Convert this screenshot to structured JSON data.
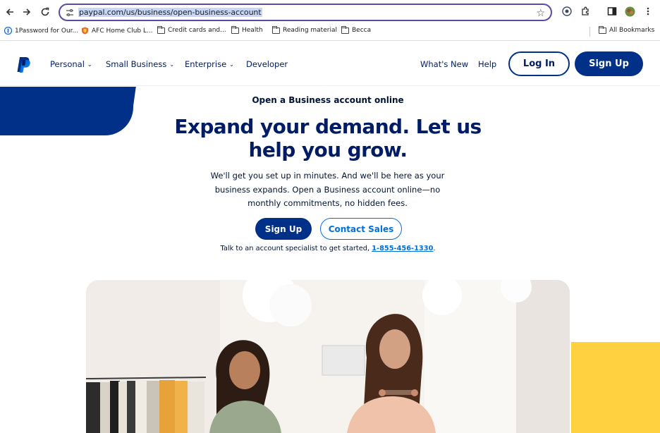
{
  "browser": {
    "url": "paypal.com/us/business/open-business-account",
    "bookmarks": [
      "1Password for Our...",
      "AFC Home Club L...",
      "Credit cards and...",
      "Health",
      "Reading material",
      "Becca"
    ],
    "all_bookmarks": "All Bookmarks"
  },
  "header": {
    "menu": [
      "Personal",
      "Small Business",
      "Enterprise",
      "Developer"
    ],
    "whats_new": "What's New",
    "help": "Help",
    "login": "Log In",
    "signup": "Sign Up"
  },
  "hero": {
    "eyebrow": "Open a Business account online",
    "headline_line1": "Expand your demand. Let us",
    "headline_line2": "help you grow.",
    "sub_line1": "We'll get you set up in minutes. And we'll be here as your",
    "sub_line2": "business expands. Open a Business account online—no",
    "sub_line3": "monthly commitments, no hidden fees.",
    "signup": "Sign Up",
    "contact": "Contact Sales",
    "talk_text": "Talk to an account specialist to get started, ",
    "phone": "1-855-456-1330",
    "talk_end": "."
  },
  "colors": {
    "brand_dark": "#003087",
    "brand_link": "#0070e0",
    "accent_yellow": "#ffd140"
  }
}
